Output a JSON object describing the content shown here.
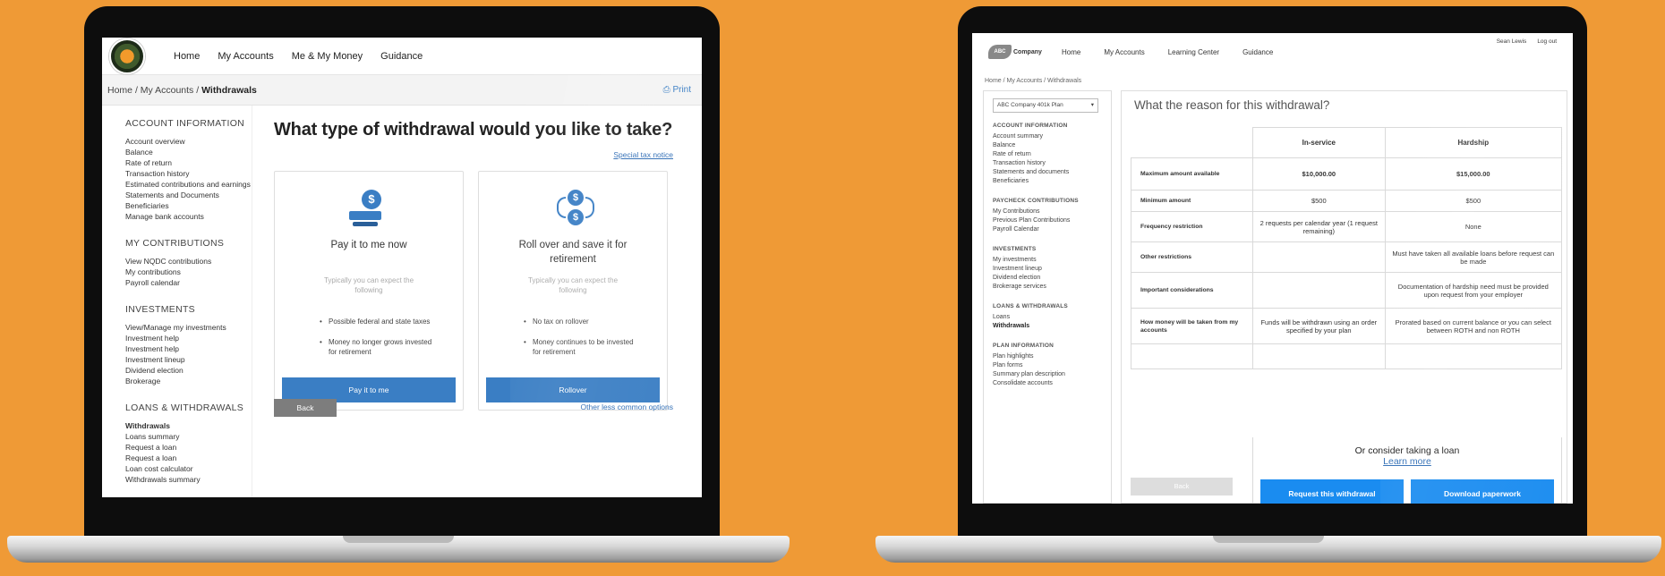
{
  "colors": {
    "background": "#ef9a36",
    "accent_blue": "#3a7ec4",
    "bright_blue": "#1a8cf0"
  },
  "left": {
    "nav": [
      "Home",
      "My Accounts",
      "Me & My Money",
      "Guidance"
    ],
    "breadcrumb": {
      "home": "Home",
      "accounts": "My Accounts",
      "current": "Withdrawals",
      "sep": "/"
    },
    "print_label": "Print",
    "sidebar": {
      "account_info": {
        "title": "ACCOUNT INFORMATION",
        "items": [
          "Account overview",
          "Balance",
          "Rate of return",
          "Transaction history",
          "Estimated contributions and earnings",
          "Statements and Documents",
          "Beneficiaries",
          "Manage bank accounts"
        ]
      },
      "contributions": {
        "title": "MY CONTRIBUTIONS",
        "items": [
          "View NQDC contributions",
          "My contributions",
          "Payroll calendar"
        ]
      },
      "investments": {
        "title": "INVESTMENTS",
        "items": [
          "View/Manage my investments",
          "Investment help",
          "Investment help",
          "Investment lineup",
          "Dividend election",
          "Brokerage"
        ]
      },
      "loans": {
        "title": "LOANS & WITHDRAWALS",
        "items": [
          "Withdrawals",
          "Loans summary",
          "Request a loan",
          "Request a loan",
          "Loan cost calculator",
          "Withdrawals summary"
        ]
      }
    },
    "title": "What type of withdrawal would you like to take?",
    "special_notice": "Special tax notice",
    "cards": [
      {
        "title": "Pay it to me now",
        "expect": "Typically you can expect the following",
        "bullets": [
          "Possible federal and state taxes",
          "Money no longer grows invested for retirement"
        ],
        "button": "Pay it to me",
        "icon": "cash-payout-icon"
      },
      {
        "title": "Roll over and save it for retirement",
        "expect": "Typically you can expect the following",
        "bullets": [
          "No tax on rollover",
          "Money continues to be invested for retirement"
        ],
        "button": "Rollover",
        "icon": "rollover-exchange-icon"
      }
    ],
    "back": "Back",
    "other_options": "Other less common options"
  },
  "right": {
    "logo": "Company",
    "logo_mark": "ABC",
    "nav": [
      "Home",
      "My Accounts",
      "Learning Center",
      "Guidance"
    ],
    "user": "Sean Lewis",
    "logout": "Log out",
    "breadcrumb": "Home  /  My Accounts  /  Withdrawals",
    "plan_select": "ABC Company 401k Plan",
    "sidebar": {
      "account_info": {
        "title": "ACCOUNT INFORMATION",
        "items": [
          "Account summary",
          "Balance",
          "Rate of return",
          "Transaction history",
          "Statements and documents",
          "Beneficiaries"
        ]
      },
      "paycheck": {
        "title": "PAYCHECK CONTRIBUTIONS",
        "items": [
          "My Contributions",
          "Previous Plan Contributions",
          "Payroll Calendar"
        ]
      },
      "investments": {
        "title": "INVESTMENTS",
        "items": [
          "My investments",
          "Investment lineup",
          "Dividend election",
          "Brokerage services"
        ]
      },
      "loans": {
        "title": "LOANS & WITHDRAWALS",
        "items": [
          "Loans",
          "Withdrawals"
        ]
      },
      "plan": {
        "title": "PLAN INFORMATION",
        "items": [
          "Plan highlights",
          "Plan forms",
          "Summary plan description",
          "Consolidate accounts"
        ]
      }
    },
    "title": "What the reason for this withdrawal?",
    "columns": [
      "In-service",
      "Hardship"
    ],
    "rows": [
      {
        "label": "Maximum amount available",
        "values": [
          "$10,000.00",
          "$15,000.00"
        ]
      },
      {
        "label": "Minimum amount",
        "values": [
          "$500",
          "$500"
        ]
      },
      {
        "label": "Frequency restriction",
        "values": [
          "2 requests per calendar year (1 request remaining)",
          "None"
        ]
      },
      {
        "label": "Other restrictions",
        "values": [
          "",
          "Must have taken all available loans before request can be made"
        ]
      },
      {
        "label": "Important considerations",
        "values": [
          "",
          "Documentation of hardship need must be provided upon request from your employer"
        ]
      },
      {
        "label": "How money will be taken from my accounts",
        "values": [
          "Funds will be withdrawn using an order specified by your plan",
          "Prorated based on current balance or you can select between ROTH and non ROTH"
        ]
      }
    ],
    "loan_text": "Or consider taking a loan",
    "learn_more": "Learn more",
    "request_btn": "Request this withdrawal",
    "download_btn": "Download paperwork",
    "back": "Back"
  }
}
